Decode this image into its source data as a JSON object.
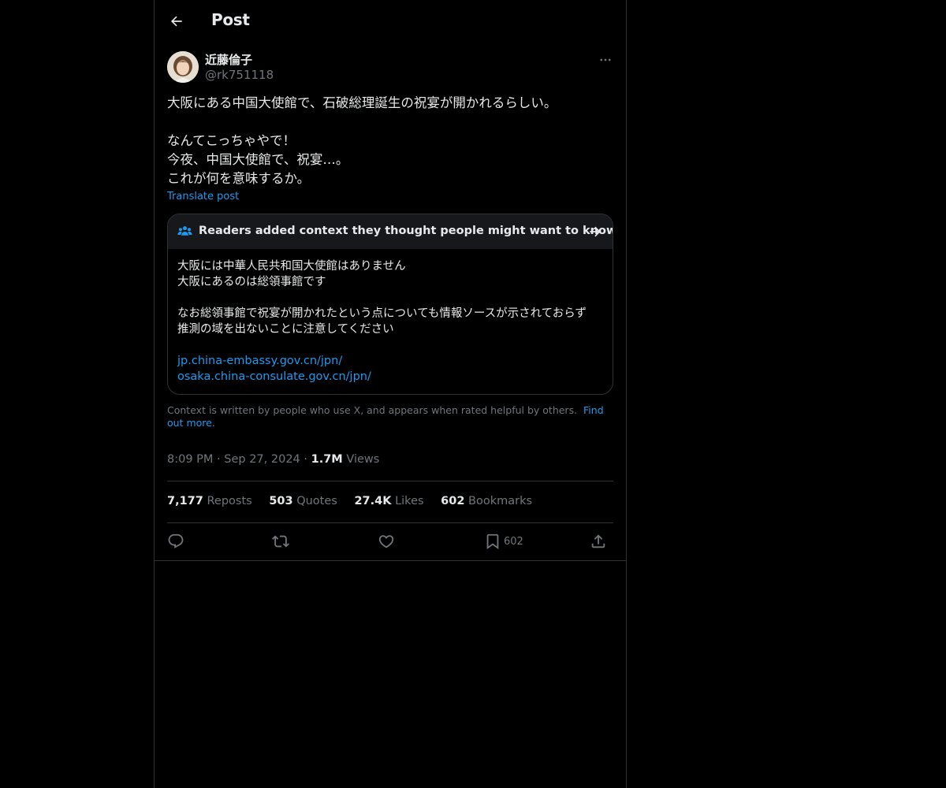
{
  "header": {
    "title": "Post"
  },
  "author": {
    "name": "近藤倫子",
    "handle": "@rk751118"
  },
  "post": {
    "lines": [
      "大阪にある中国大使館で、石破総理誕生の祝宴が開かれるらしい。",
      "",
      "なんてこっちゃやで！",
      "今夜、中国大使館で、祝宴…。",
      "これが何を意味するか。"
    ],
    "translate_label": "Translate post"
  },
  "community_note": {
    "header": "Readers added context they thought people might want to know",
    "lines": [
      "大阪には中華人民共和国大使館はありません",
      "大阪にあるのは総領事館です",
      "",
      "なお総領事館で祝宴が開かれたという点についても情報ソースが示されておらず",
      "推測の域を出ないことに注意してください",
      ""
    ],
    "links": [
      "jp.china-embassy.gov.cn/jpn/",
      "osaka.china-consulate.gov.cn/jpn/"
    ]
  },
  "disclaimer": {
    "text": "Context is written by people who use X, and appears when rated helpful by others.",
    "link": "Find out more."
  },
  "meta": {
    "time": "8:09 PM",
    "date": "Sep 27, 2024",
    "views_count": "1.7M",
    "views_label": "Views",
    "separator": "·"
  },
  "stats": [
    {
      "count": "7,177",
      "label": "Reposts"
    },
    {
      "count": "503",
      "label": "Quotes"
    },
    {
      "count": "27.4K",
      "label": "Likes"
    },
    {
      "count": "602",
      "label": "Bookmarks"
    }
  ],
  "actions": {
    "bookmark_count": "602"
  },
  "colors": {
    "background": "#000000",
    "text": "#e7e9ea",
    "muted": "#71767b",
    "accent": "#1d9bf0",
    "border": "#2f3336"
  },
  "icons": [
    "back-arrow-icon",
    "more-icon",
    "people-icon",
    "arrow-right-icon",
    "reply-icon",
    "repost-icon",
    "like-icon",
    "bookmark-icon",
    "share-icon"
  ]
}
